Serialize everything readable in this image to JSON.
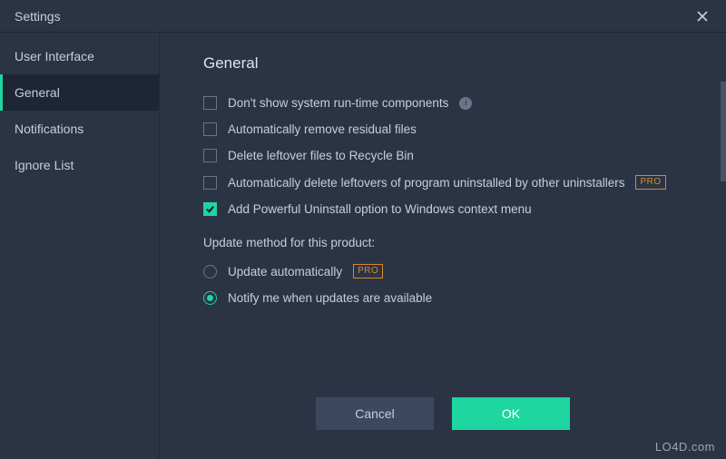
{
  "window": {
    "title": "Settings"
  },
  "sidebar": {
    "items": [
      {
        "label": "User Interface",
        "active": false
      },
      {
        "label": "General",
        "active": true
      },
      {
        "label": "Notifications",
        "active": false
      },
      {
        "label": "Ignore List",
        "active": false
      }
    ]
  },
  "section": {
    "heading": "General",
    "checkboxes": [
      {
        "label": "Don't show system run-time components",
        "checked": false,
        "info": true,
        "pro": false
      },
      {
        "label": "Automatically remove residual files",
        "checked": false,
        "info": false,
        "pro": false
      },
      {
        "label": "Delete leftover files to Recycle Bin",
        "checked": false,
        "info": false,
        "pro": false
      },
      {
        "label": "Automatically delete leftovers of program uninstalled by other uninstallers",
        "checked": false,
        "info": false,
        "pro": true
      },
      {
        "label": "Add Powerful Uninstall option to Windows context menu",
        "checked": true,
        "info": false,
        "pro": false
      }
    ],
    "updateHeading": "Update method for this product:",
    "radios": [
      {
        "label": "Update automatically",
        "selected": false,
        "pro": true
      },
      {
        "label": "Notify me when updates are available",
        "selected": true,
        "pro": false
      }
    ]
  },
  "badges": {
    "pro": "PRO"
  },
  "buttons": {
    "cancel": "Cancel",
    "ok": "OK"
  },
  "watermark": "LO4D.com"
}
